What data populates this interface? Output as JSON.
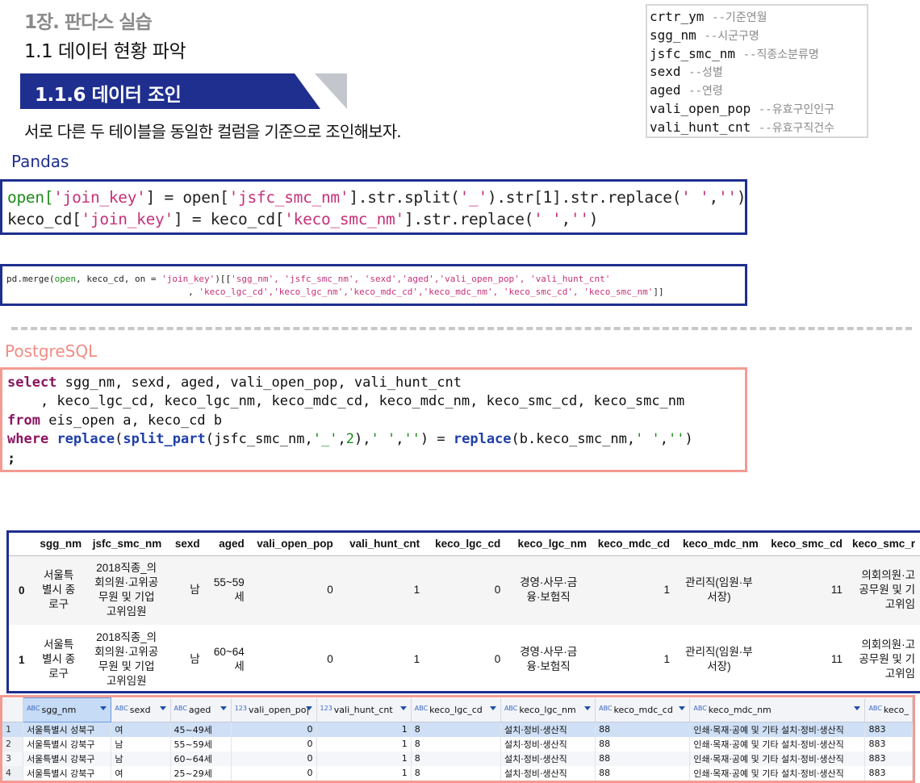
{
  "header": {
    "chapter": "1장. 판다스 실습",
    "subtitle": "1.1 데이터 현황 파악",
    "banner": "1.1.6 데이터 조인",
    "description": "서로 다른 두 테이블을 동일한 컬럼을 기준으로 조인해보자."
  },
  "legend": [
    {
      "col": " crtr_ym",
      "comment": "--기준연월"
    },
    {
      "col": "sgg_nm",
      "comment": "--시군구명"
    },
    {
      "col": "jsfc_smc_nm",
      "comment": "--직종소분류명"
    },
    {
      "col": "sexd",
      "comment": "--성별"
    },
    {
      "col": "aged",
      "comment": "--연령"
    },
    {
      "col": "vali_open_pop",
      "comment": "--유효구인인구"
    },
    {
      "col": "vali_hunt_cnt",
      "comment": "--유효구직건수"
    }
  ],
  "sections": {
    "pandas": "Pandas",
    "postgres": "PostgreSQL"
  },
  "pandas_code": {
    "l1": [
      "open[",
      "'join_key'",
      "] = open[",
      "'jsfc_smc_nm'",
      "].str.split(",
      "'_'",
      ").str[1].str.replace(",
      "' '",
      ",",
      "''",
      ")"
    ],
    "l2": [
      "keco_cd[",
      "'join_key'",
      "] = keco_cd[",
      "'keco_smc_nm'",
      "].str.replace(",
      "' '",
      ",",
      "''",
      ")"
    ]
  },
  "merge_code": {
    "l1_a": "pd.merge(",
    "l1_b": "open",
    "l1_c": ", keco_cd, on = ",
    "l1_d": "'join_key'",
    "l1_e": ")[[",
    "l1_f": "'sgg_nm', 'jsfc_smc_nm', 'sexd','aged','vali_open_pop', 'vali_hunt_cnt'",
    "l2_a": "                                  , ",
    "l2_b": "'keco_lgc_cd','keco_lgc_nm','keco_mdc_cd','keco_mdc_nm', 'keco_smc_cd', 'keco_smc_nm'",
    "l2_c": "]]"
  },
  "sql_code": {
    "l1_kw": "select",
    "l1_rest": " sgg_nm, sexd, aged, vali_open_pop, vali_hunt_cnt",
    "l2": "    , keco_lgc_cd, keco_lgc_nm, keco_mdc_cd, keco_mdc_nm, keco_smc_cd, keco_smc_nm",
    "l3_kw": "from",
    "l3_rest": " eis_open a, keco_cd b",
    "l4_kw": "where",
    "l4_fn1": "replace",
    "l4_p1": "(",
    "l4_fn2": "split_part",
    "l4_p2": "(jsfc_smc_nm,",
    "l4_s1": "'_'",
    "l4_p3": ",",
    "l4_n": "2",
    "l4_p4": "),",
    "l4_s2": "' '",
    "l4_p5": ",",
    "l4_s3": "''",
    "l4_p6": ") = ",
    "l4_fn3": "replace",
    "l4_p7": "(b.keco_smc_nm,",
    "l4_s4": "' '",
    "l4_p8": ",",
    "l4_s5": "''",
    "l4_p9": ")",
    "l5": ";"
  },
  "dataframe": {
    "columns": [
      "",
      "sgg_nm",
      "jsfc_smc_nm",
      "sexd",
      "aged",
      "vali_open_pop",
      "vali_hunt_cnt",
      "keco_lgc_cd",
      "keco_lgc_nm",
      "keco_mdc_cd",
      "keco_mdc_nm",
      "keco_smc_cd",
      "keco_smc_r"
    ],
    "rows": [
      [
        "0",
        "서울특\n별시 종\n로구",
        "2018직종_의\n회의원·고위공\n무원 및 기업\n고위임원",
        "남",
        "55~59\n세",
        "0",
        "1",
        "0",
        "경영·사무·금\n융·보험직",
        "1",
        "관리직(임원·부\n서장)",
        "11",
        "의회의원·고\n공무원 및 기\n고위임"
      ],
      [
        "1",
        "서울특\n별시 종\n로구",
        "2018직종_의\n회의원·고위공\n무원 및 기업\n고위임원",
        "남",
        "60~64\n세",
        "0",
        "1",
        "0",
        "경영·사무·금\n융·보험직",
        "1",
        "관리직(임원·부\n서장)",
        "11",
        "의회의원·고\n공무원 및 기\n고위임"
      ]
    ]
  },
  "grid": {
    "columns": [
      {
        "type": "ABC",
        "name": "sgg_nm"
      },
      {
        "type": "ABC",
        "name": "sexd"
      },
      {
        "type": "ABC",
        "name": "aged"
      },
      {
        "type": "123",
        "name": "vali_open_po|"
      },
      {
        "type": "123",
        "name": "vali_hunt_cnt"
      },
      {
        "type": "ABC",
        "name": "keco_lgc_cd"
      },
      {
        "type": "ABC",
        "name": "keco_lgc_nm"
      },
      {
        "type": "ABC",
        "name": "keco_mdc_cd"
      },
      {
        "type": "ABC",
        "name": "keco_mdc_nm"
      },
      {
        "type": "ABC",
        "name": "keco_"
      }
    ],
    "rows": [
      [
        "1",
        "서울특별시 성북구",
        "여",
        "45~49세",
        "0",
        "1",
        "8",
        "설치·정비·생산직",
        "88",
        "인쇄·목재·공예 및 기타 설치·정비·생산직",
        "883"
      ],
      [
        "2",
        "서울특별시 강북구",
        "남",
        "55~59세",
        "0",
        "1",
        "8",
        "설치·정비·생산직",
        "88",
        "인쇄·목재·공예 및 기타 설치·정비·생산직",
        "883"
      ],
      [
        "3",
        "서울특별시 강북구",
        "남",
        "60~64세",
        "0",
        "1",
        "8",
        "설치·정비·생산직",
        "88",
        "인쇄·목재·공예 및 기타 설치·정비·생산직",
        "883"
      ],
      [
        "4",
        "서울특별시 강북구",
        "여",
        "25~29세",
        "0",
        "1",
        "8",
        "설치·정비·생산직",
        "88",
        "인쇄·목재·공예 및 기타 설치·정비·생산직",
        "883"
      ]
    ]
  }
}
